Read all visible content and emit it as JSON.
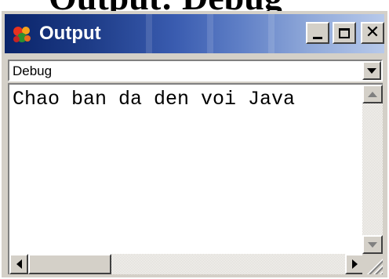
{
  "background": {
    "text": "Output: Debug"
  },
  "window": {
    "title": "Output",
    "icon": "coffee-cup-icon",
    "controls": [
      "minimize-icon",
      "maximize-icon",
      "close-icon"
    ]
  },
  "combo": {
    "selected": "Debug"
  },
  "output": {
    "text": "Chao ban da den voi Java"
  },
  "colors": {
    "title_start": "#0a246a",
    "title_end": "#b7c9ea",
    "chrome": "#d4d0c8"
  }
}
